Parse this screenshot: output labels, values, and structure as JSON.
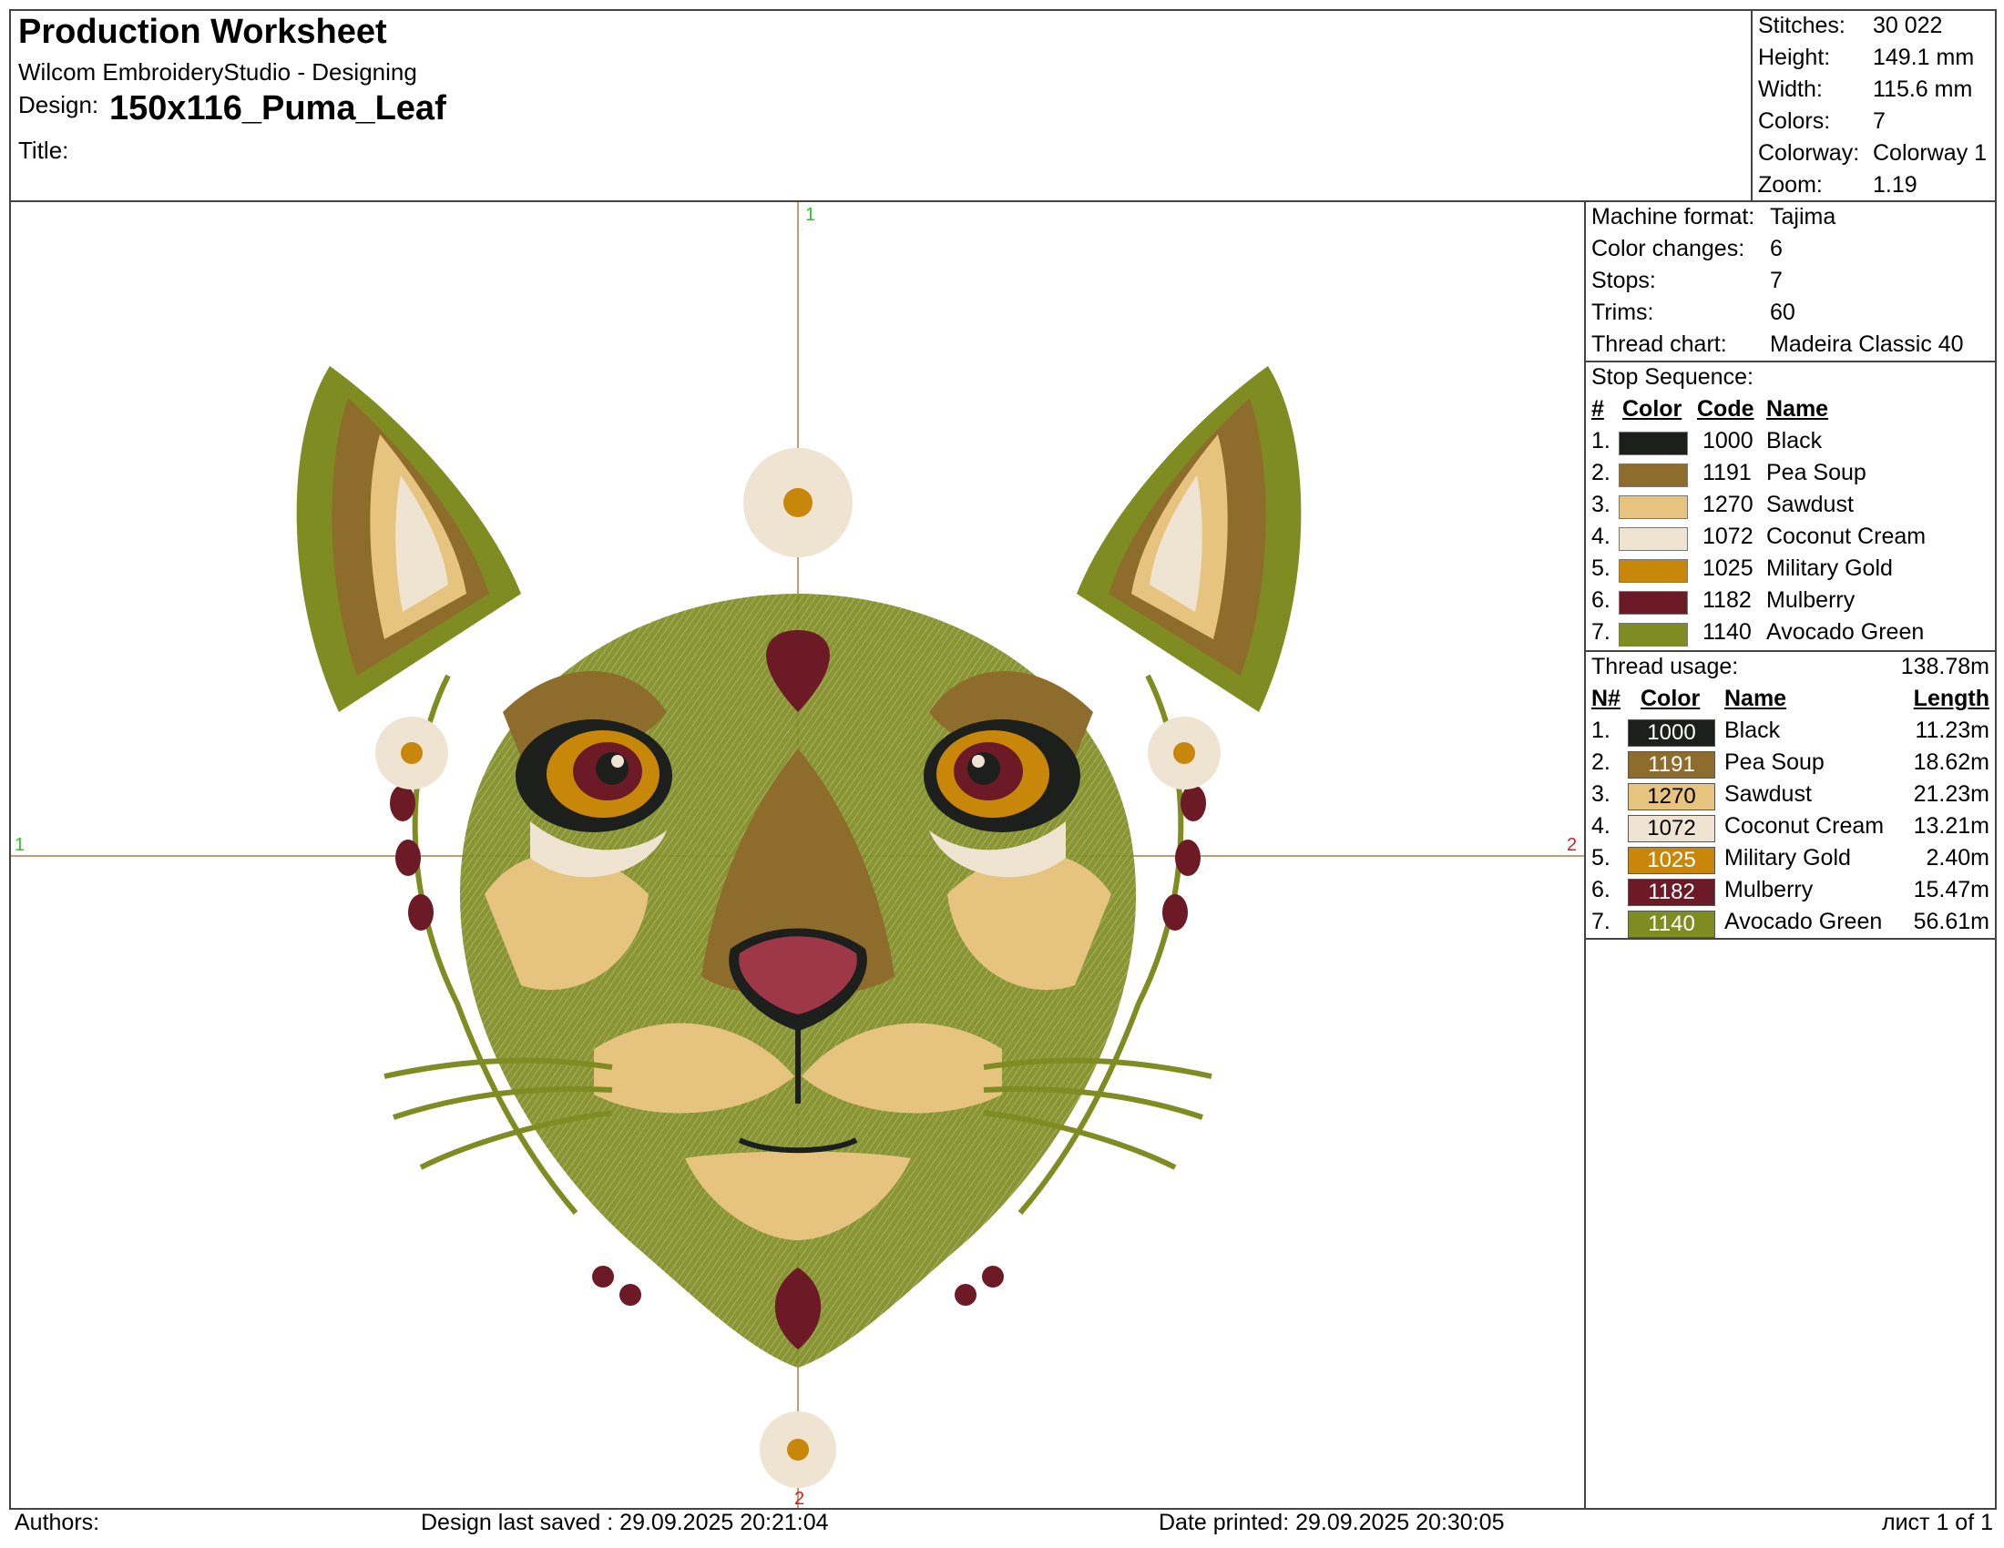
{
  "header": {
    "title": "Production Worksheet",
    "app": "Wilcom EmbroideryStudio - Designing",
    "design_label": "Design:",
    "design_name": "150x116_Puma_Leaf",
    "title_label": "Title:"
  },
  "stats": [
    {
      "label": "Stitches:",
      "value": "30 022"
    },
    {
      "label": "Height:",
      "value": "149.1 mm"
    },
    {
      "label": "Width:",
      "value": "115.6 mm"
    },
    {
      "label": "Colors:",
      "value": "7"
    },
    {
      "label": "Colorway:",
      "value": "Colorway 1"
    },
    {
      "label": "Zoom:",
      "value": "1.19"
    }
  ],
  "machine": [
    {
      "label": "Machine format:",
      "value": "Tajima"
    },
    {
      "label": "Color changes:",
      "value": "6"
    },
    {
      "label": "Stops:",
      "value": "7"
    },
    {
      "label": "Trims:",
      "value": "60"
    },
    {
      "label": "Thread chart:",
      "value": "Madeira Classic 40"
    }
  ],
  "stop_sequence": {
    "title": "Stop Sequence:",
    "headers": [
      "#",
      "Color",
      "Code",
      "Name"
    ],
    "rows": [
      {
        "n": "1.",
        "color": "#1c1f1c",
        "code": "1000",
        "name": "Black"
      },
      {
        "n": "2.",
        "color": "#8e6d2c",
        "code": "1191",
        "name": "Pea Soup"
      },
      {
        "n": "3.",
        "color": "#e6c47f",
        "code": "1270",
        "name": "Sawdust"
      },
      {
        "n": "4.",
        "color": "#efe3d2",
        "code": "1072",
        "name": "Coconut Cream"
      },
      {
        "n": "5.",
        "color": "#c88708",
        "code": "1025",
        "name": "Military Gold"
      },
      {
        "n": "6.",
        "color": "#6c1a26",
        "code": "1182",
        "name": "Mulberry"
      },
      {
        "n": "7.",
        "color": "#7f8c22",
        "code": "1140",
        "name": "Avocado Green"
      }
    ]
  },
  "thread_usage": {
    "title": "Thread usage:",
    "total": "138.78m",
    "headers": [
      "N#",
      "Color",
      "Name",
      "Length"
    ],
    "rows": [
      {
        "n": "1.",
        "color": "#1c1f1c",
        "code": "1000",
        "text_color": "#ffffff",
        "name": "Black",
        "length": "11.23m"
      },
      {
        "n": "2.",
        "color": "#8e6d2c",
        "code": "1191",
        "text_color": "#ffffff",
        "name": "Pea Soup",
        "length": "18.62m"
      },
      {
        "n": "3.",
        "color": "#e6c47f",
        "code": "1270",
        "text_color": "#000000",
        "name": "Sawdust",
        "length": "21.23m"
      },
      {
        "n": "4.",
        "color": "#efe3d2",
        "code": "1072",
        "text_color": "#000000",
        "name": "Coconut Cream",
        "length": "13.21m"
      },
      {
        "n": "5.",
        "color": "#c88708",
        "code": "1025",
        "text_color": "#ffffff",
        "name": "Military Gold",
        "length": "2.40m"
      },
      {
        "n": "6.",
        "color": "#6c1a26",
        "code": "1182",
        "text_color": "#ffffff",
        "name": "Mulberry",
        "length": "15.47m"
      },
      {
        "n": "7.",
        "color": "#7f8c22",
        "code": "1140",
        "text_color": "#ffffff",
        "name": "Avocado Green",
        "length": "56.61m"
      }
    ]
  },
  "canvas": {
    "markers": {
      "top": "1",
      "bottom": "2",
      "left": "1",
      "right": "2"
    },
    "marker_start_color": "#22cc22",
    "marker_end_color": "#cc2222",
    "crosshair_color": "#b07a4a"
  },
  "footer": {
    "authors": "Authors:",
    "saved": "Design last saved : 29.09.2025 20:21:04",
    "printed": "Date printed: 29.09.2025 20:30:05",
    "page": "лист 1 of 1"
  }
}
